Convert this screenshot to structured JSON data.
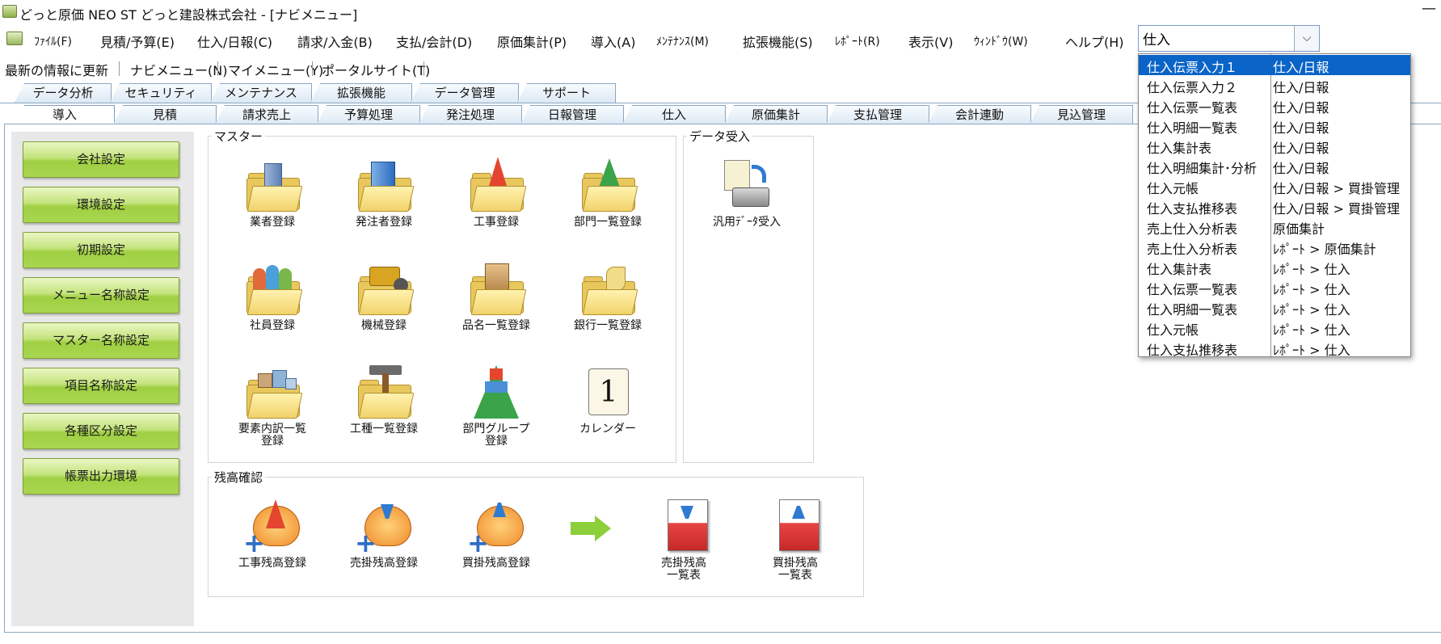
{
  "window": {
    "title": "どっと原価 NEO ST どっと建設株式会社 - [ナビメニュー]",
    "minimize": "—"
  },
  "menubar": {
    "items": [
      {
        "label": "ﾌｧｲﾙ(F)"
      },
      {
        "label": "見積/予算(E)"
      },
      {
        "label": "仕入/日報(C)"
      },
      {
        "label": "請求/入金(B)"
      },
      {
        "label": "支払/会計(D)"
      },
      {
        "label": "原価集計(P)"
      },
      {
        "label": "導入(A)"
      },
      {
        "label": "ﾒﾝﾃﾅﾝｽ(M)"
      },
      {
        "label": "拡張機能(S)"
      },
      {
        "label": "ﾚﾎﾟｰﾄ(R)"
      },
      {
        "label": "表示(V)"
      },
      {
        "label": "ｳｨﾝﾄﾞｳ(W)"
      },
      {
        "label": "ヘルプ(H)"
      }
    ]
  },
  "search": {
    "value": "仕入",
    "dropdown_icon": "chevron-down-icon"
  },
  "toolbar2": {
    "refresh": "最新の情報に更新",
    "navi": "ナビメニュー(N)",
    "my": "マイメニュー(Y)",
    "portal": "ポータルサイト(T)"
  },
  "tabs_top": [
    "データ分析",
    "セキュリティ",
    "メンテナンス",
    "拡張機能",
    "データ管理",
    "サポート"
  ],
  "tabs_main": [
    "導入",
    "見積",
    "請求売上",
    "予算処理",
    "発注処理",
    "日報管理",
    "仕入",
    "原価集計",
    "支払管理",
    "会計連動",
    "見込管理"
  ],
  "sidebar": {
    "buttons": [
      "会社設定",
      "環境設定",
      "初期設定",
      "メニュー名称設定",
      "マスター名称設定",
      "項目名称設定",
      "各種区分設定",
      "帳票出力環境"
    ]
  },
  "master": {
    "label": "マスター",
    "items": [
      {
        "label": "業者登録",
        "icon": "building-folder-icon"
      },
      {
        "label": "発注者登録",
        "icon": "office-folder-icon"
      },
      {
        "label": "工事登録",
        "icon": "cone-folder-icon"
      },
      {
        "label": "部門一覧登録",
        "icon": "pyramid-folder-icon"
      },
      {
        "label": "社員登録",
        "icon": "people-folder-icon"
      },
      {
        "label": "機械登録",
        "icon": "bulldozer-folder-icon"
      },
      {
        "label": "品名一覧登録",
        "icon": "box-folder-icon"
      },
      {
        "label": "銀行一覧登録",
        "icon": "bank-folder-icon"
      },
      {
        "label": "要素内訳一覧\n登録",
        "icon": "blocks-folder-icon"
      },
      {
        "label": "工種一覧登録",
        "icon": "hammer-folder-icon"
      },
      {
        "label": "部門グループ\n登録",
        "icon": "pyramid-icon"
      },
      {
        "label": "カレンダー",
        "icon": "calendar-icon"
      }
    ]
  },
  "data_import": {
    "label": "データ受入",
    "items": [
      {
        "label": "汎用ﾃﾞｰﾀ受入",
        "icon": "import-disk-icon"
      }
    ]
  },
  "balance": {
    "label": "残高確認",
    "items": [
      {
        "label": "工事残高登録",
        "icon": "cone-bag-add-icon"
      },
      {
        "label": "売掛残高登録",
        "icon": "receivable-bag-add-icon"
      },
      {
        "label": "買掛残高登録",
        "icon": "payable-bag-add-icon"
      },
      {
        "label": "売掛残高\n一覧表",
        "icon": "receivable-report-icon"
      },
      {
        "label": "買掛残高\n一覧表",
        "icon": "payable-report-icon"
      }
    ]
  },
  "dropdown": {
    "rows": [
      {
        "name": "仕入伝票入力１",
        "path": "仕入/日報",
        "selected": true
      },
      {
        "name": "仕入伝票入力２",
        "path": "仕入/日報"
      },
      {
        "name": "仕入伝票一覧表",
        "path": "仕入/日報"
      },
      {
        "name": "仕入明細一覧表",
        "path": "仕入/日報"
      },
      {
        "name": "仕入集計表",
        "path": "仕入/日報"
      },
      {
        "name": "仕入明細集計･分析",
        "path": "仕入/日報"
      },
      {
        "name": "仕入元帳",
        "path": "仕入/日報 > 買掛管理"
      },
      {
        "name": "仕入支払推移表",
        "path": "仕入/日報 > 買掛管理"
      },
      {
        "name": "売上仕入分析表",
        "path": "原価集計"
      },
      {
        "name": "売上仕入分析表",
        "path": "ﾚﾎﾟｰﾄ > 原価集計"
      },
      {
        "name": "仕入集計表",
        "path": "ﾚﾎﾟｰﾄ > 仕入"
      },
      {
        "name": "仕入伝票一覧表",
        "path": "ﾚﾎﾟｰﾄ > 仕入"
      },
      {
        "name": "仕入明細一覧表",
        "path": "ﾚﾎﾟｰﾄ > 仕入"
      },
      {
        "name": "仕入元帳",
        "path": "ﾚﾎﾟｰﾄ > 仕入"
      },
      {
        "name": "仕入支払推移表",
        "path": "ﾚﾎﾟｰﾄ > 仕入"
      }
    ]
  },
  "colors": {
    "accent": "#0a64c8",
    "button_green": "#a9d64f",
    "tab_border": "#8aa7c3"
  }
}
